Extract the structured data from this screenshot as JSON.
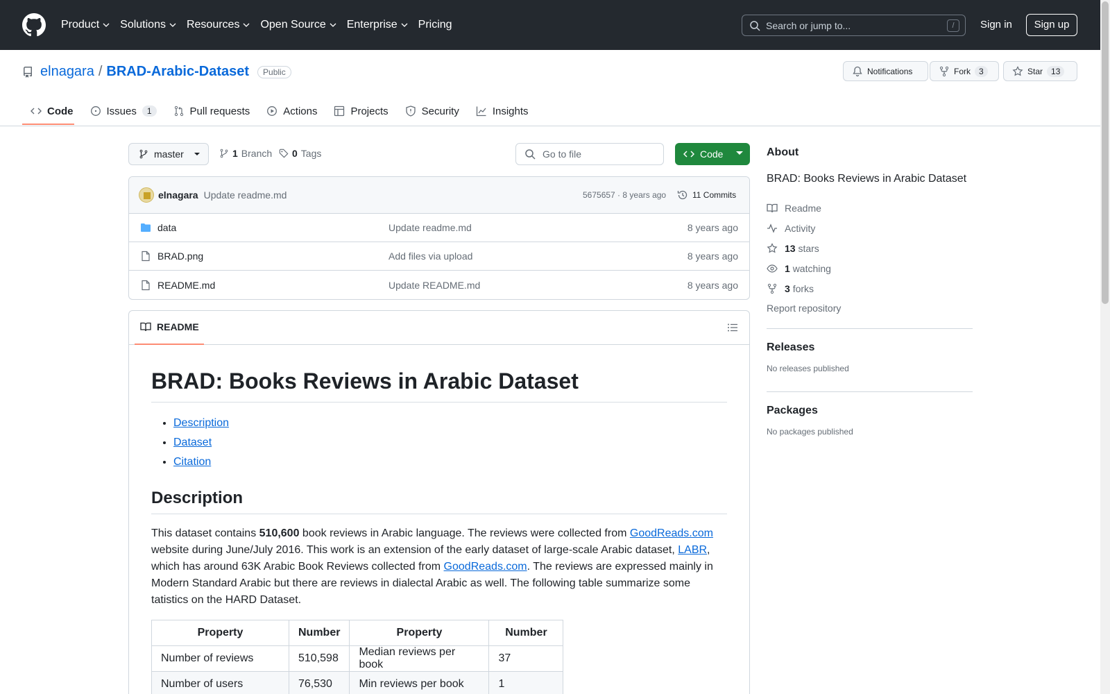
{
  "header": {
    "nav": [
      "Product",
      "Solutions",
      "Resources",
      "Open Source",
      "Enterprise",
      "Pricing"
    ],
    "search_placeholder": "Search or jump to...",
    "search_shortcut": "/",
    "signin": "Sign in",
    "signup": "Sign up"
  },
  "repo": {
    "owner": "elnagara",
    "separator": "/",
    "name": "BRAD-Arabic-Dataset",
    "visibility": "Public",
    "notifications_label": "Notifications",
    "fork_label": "Fork",
    "fork_count": "3",
    "star_label": "Star",
    "star_count": "13"
  },
  "tabs": [
    {
      "label": "Code"
    },
    {
      "label": "Issues",
      "count": "1"
    },
    {
      "label": "Pull requests"
    },
    {
      "label": "Actions"
    },
    {
      "label": "Projects"
    },
    {
      "label": "Security"
    },
    {
      "label": "Insights"
    }
  ],
  "toolbar": {
    "branch": "master",
    "branch_count": "1",
    "branch_label": "Branch",
    "tag_count": "0",
    "tag_label": "Tags",
    "gofile_placeholder": "Go to file",
    "code_button": "Code"
  },
  "commit": {
    "author": "elnagara",
    "message": "Update readme.md",
    "sha": "5675657 · 8 years ago",
    "commits": "11 Commits"
  },
  "files": [
    {
      "name": "data",
      "type": "folder",
      "message": "Update readme.md",
      "age": "8 years ago"
    },
    {
      "name": "BRAD.png",
      "type": "file",
      "message": "Add files via upload",
      "age": "8 years ago"
    },
    {
      "name": "README.md",
      "type": "file",
      "message": "Update README.md",
      "age": "8 years ago"
    }
  ],
  "readme": {
    "tab_label": "README",
    "h1": "BRAD: Books Reviews in Arabic Dataset",
    "toc": [
      "Description",
      "Dataset",
      "Citation"
    ],
    "h2": "Description",
    "para": {
      "t1": "This dataset contains ",
      "b1": "510,600",
      "t2": " book reviews in Arabic language. The reviews were collected from ",
      "l1": "GoodReads.com",
      "t3": " website during June/July 2016. This work is an extension of the early dataset of large-scale Arabic dataset, ",
      "l2": "LABR",
      "t4": ", which has around 63K Arabic Book Reviews collected from ",
      "l3": "GoodReads.com",
      "t5": ". The reviews are expressed mainly in Modern Standard Arabic but there are reviews in dialectal Arabic as well. The following table summarize some tatistics on the HARD Dataset."
    },
    "table": {
      "headers": [
        "Property",
        "Number",
        "Property",
        "Number"
      ],
      "rows": [
        [
          "Number of reviews",
          "510,598",
          "Median reviews per book",
          "37"
        ],
        [
          "Number of users",
          "76,530",
          "Min reviews per book",
          "1"
        ]
      ]
    }
  },
  "about": {
    "title": "About",
    "description": "BRAD: Books Reviews in Arabic Dataset",
    "readme": "Readme",
    "activity": "Activity",
    "stars_count": "13",
    "stars_label": "stars",
    "watching_count": "1",
    "watching_label": "watching",
    "forks_count": "3",
    "forks_label": "forks",
    "report": "Report repository"
  },
  "releases": {
    "title": "Releases",
    "empty": "No releases published"
  },
  "packages": {
    "title": "Packages",
    "empty": "No packages published"
  },
  "colors": {
    "header_bg": "#24292f",
    "link": "#0969da",
    "accent_underline": "#fd8c73",
    "code_button": "#1f883d"
  }
}
